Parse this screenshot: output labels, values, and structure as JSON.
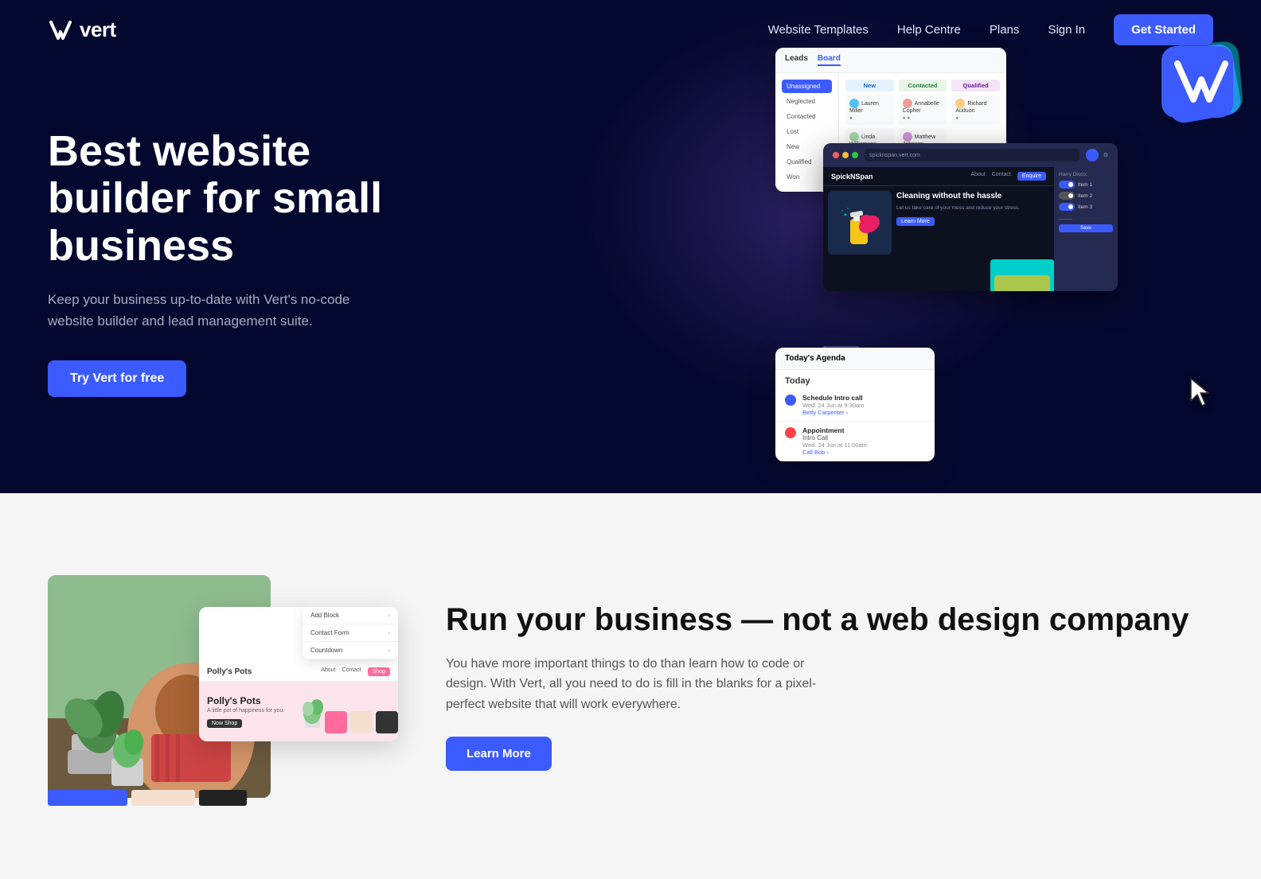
{
  "navbar": {
    "logo_text": "vert",
    "nav_items": [
      {
        "id": "website-templates",
        "label": "Website Templates"
      },
      {
        "id": "help-centre",
        "label": "Help Centre"
      },
      {
        "id": "plans",
        "label": "Plans"
      },
      {
        "id": "sign-in",
        "label": "Sign In"
      }
    ],
    "cta_label": "Get Started"
  },
  "hero": {
    "title": "Best website builder for small business",
    "subtitle": "Keep your business up-to-date with Vert's no-code website builder and lead management suite.",
    "cta_label": "Try Vert for free"
  },
  "crm_panel": {
    "header_leads": "Leads",
    "header_board": "Board",
    "sidebar_items": [
      "Unassigned",
      "Neglected",
      "Contacted",
      "Lost",
      "New",
      "Qualified",
      "Won"
    ],
    "active_item": "Board",
    "columns": [
      "New",
      "Contacted",
      "Qualified"
    ],
    "cards": [
      {
        "name": "Lauren Miller",
        "col": "New"
      },
      {
        "name": "Annabelle Copher",
        "col": "Contacted"
      },
      {
        "name": "Richard Auduon",
        "col": "Qualified"
      },
      {
        "name": "Linda Williamson",
        "col": "New"
      },
      {
        "name": "Matthew Johnson",
        "col": "Contacted"
      }
    ]
  },
  "builder_panel": {
    "url_bar": "spicknspan.vert.com",
    "site_name": "SpickNSpan",
    "nav_links": [
      "About",
      "Contact"
    ],
    "enquire_btn": "Enquire",
    "hero_heading": "Cleaning without the hassle",
    "hero_desc": "Let us take care of your mess and reduce your stress.",
    "learn_more_btn": "Learn More",
    "sidebar_label": "Harry Disco:",
    "toggles": [
      "Item 1",
      "Item 2",
      "Item 3"
    ]
  },
  "agenda_panel": {
    "title": "Today's Agenda",
    "date_label": "Today",
    "items": [
      {
        "title": "Schedule Intro call",
        "time": "Wed. 24 Jun at 9:30am",
        "person": "Betty Carpenter",
        "color": "#3b5bff"
      },
      {
        "title": "Appointment",
        "subtitle": "Intro Call",
        "time": "Wed. 24 Jun at 11:00am",
        "action": "Call Bob",
        "color": "#ff4444"
      }
    ]
  },
  "section2": {
    "title": "Run your business — not a web design company",
    "description": "You have more important things to do than learn how to code or design. With Vert, all you need to do is fill in the blanks for a pixel-perfect website that will work everywhere.",
    "cta_label": "Learn More",
    "builder_site_name": "Polly's Pots",
    "builder_tagline": "A little pot of happiness for you.",
    "shop_btn": "Now Shop",
    "blocks": [
      "Add Block",
      "Contact Form",
      "Countdown"
    ]
  },
  "colors": {
    "primary_blue": "#3b5bff",
    "hero_bg": "#05082e",
    "section2_bg": "#f5f5f5",
    "accent_pink": "#ff6b9d",
    "accent_teal": "#00d2c8"
  }
}
